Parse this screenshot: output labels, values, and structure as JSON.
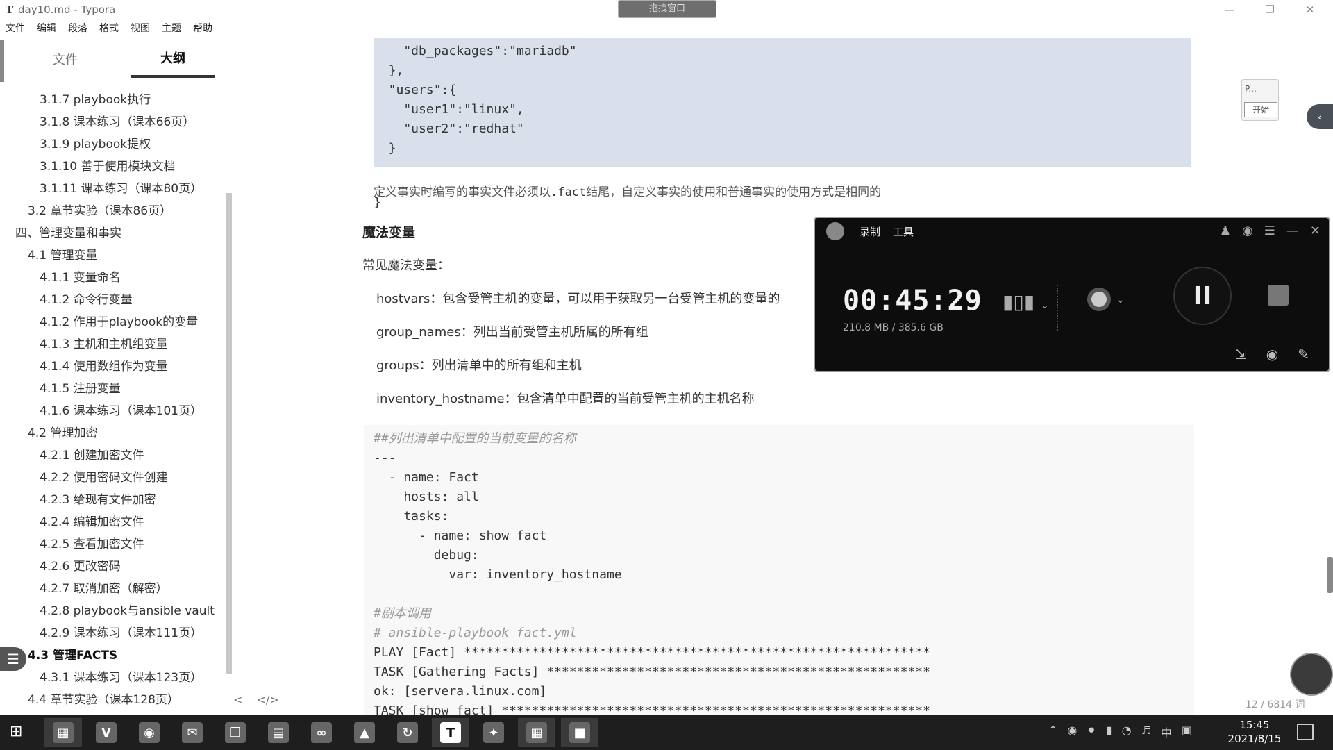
{
  "window": {
    "title": "day10.md - Typora",
    "app_icon": "T",
    "menu": [
      "文件",
      "编辑",
      "段落",
      "格式",
      "视图",
      "主题",
      "帮助"
    ],
    "tip_badge": "拖拽窗口"
  },
  "sidebar": {
    "tabs": [
      {
        "label": "文件",
        "active": false
      },
      {
        "label": "大纲",
        "active": true
      }
    ],
    "outline": [
      {
        "label": "3.1.7 playbook执行",
        "level": 3
      },
      {
        "label": "3.1.8 课本练习（课本66页）",
        "level": 3
      },
      {
        "label": "3.1.9 playbook提权",
        "level": 3
      },
      {
        "label": "3.1.10 善于使用模块文档",
        "level": 3
      },
      {
        "label": "3.1.11 课本练习（课本80页）",
        "level": 3
      },
      {
        "label": "3.2 章节实验（课本86页）",
        "level": 2
      },
      {
        "label": "四、管理变量和事实",
        "level": 1
      },
      {
        "label": "4.1 管理变量",
        "level": 2
      },
      {
        "label": "4.1.1 变量命名",
        "level": 3
      },
      {
        "label": "4.1.2 命令行变量",
        "level": 3
      },
      {
        "label": "4.1.2 作用于playbook的变量",
        "level": 3
      },
      {
        "label": "4.1.3 主机和主机组变量",
        "level": 3
      },
      {
        "label": "4.1.4 使用数组作为变量",
        "level": 3
      },
      {
        "label": "4.1.5 注册变量",
        "level": 3
      },
      {
        "label": "4.1.6 课本练习（课本101页）",
        "level": 3
      },
      {
        "label": "4.2 管理加密",
        "level": 2
      },
      {
        "label": "4.2.1 创建加密文件",
        "level": 3
      },
      {
        "label": "4.2.2 使用密码文件创建",
        "level": 3
      },
      {
        "label": "4.2.3 给现有文件加密",
        "level": 3
      },
      {
        "label": "4.2.4 编辑加密文件",
        "level": 3
      },
      {
        "label": "4.2.5 查看加密文件",
        "level": 3
      },
      {
        "label": "4.2.6 更改密码",
        "level": 3
      },
      {
        "label": "4.2.7 取消加密（解密）",
        "level": 3
      },
      {
        "label": "4.2.8 playbook与ansible vault",
        "level": 3
      },
      {
        "label": "4.2.9 课本练习（课本111页）",
        "level": 3
      },
      {
        "label": "4.3 管理FACTS",
        "level": 2,
        "active": true
      },
      {
        "label": "4.3.1 课本练习（课本123页）",
        "level": 3
      },
      {
        "label": "4.4 章节实验（课本128页）",
        "level": 2
      }
    ],
    "footer_prev": "<",
    "footer_source": "</>"
  },
  "editor": {
    "codeblock1": [
      "    \"db_packages\":\"mariadb\"",
      "  },",
      "  \"users\":{",
      "    \"user1\":\"linux\",",
      "    \"user2\":\"redhat\"",
      "  }"
    ],
    "codeblock1_tail": "}",
    "note_pre": "定义事实时编写的事实文件必须以",
    "note_code": ".fact",
    "note_post": "结尾，自定义事实的使用和普通事实的使用方式是相同的",
    "heading": "魔法变量",
    "intro": "常见魔法变量：",
    "items": [
      "hostvars：包含受管主机的变量，可以用于获取另一台受管主机的变量的",
      "group_names：列出当前受管主机所属的所有组",
      "groups：列出清单中的所有组和主机",
      "inventory_hostname：包含清单中配置的当前受管主机的主机名称"
    ],
    "codeblock2": [
      {
        "text": "##列出清单中配置的当前变量的名称",
        "comment": true
      },
      {
        "text": "---",
        "comment": false
      },
      {
        "text": "  - name: Fact",
        "comment": false
      },
      {
        "text": "    hosts: all",
        "comment": false
      },
      {
        "text": "    tasks:",
        "comment": false
      },
      {
        "text": "      - name: show fact",
        "comment": false
      },
      {
        "text": "        debug:",
        "comment": false
      },
      {
        "text": "          var: inventory_hostname",
        "comment": false
      },
      {
        "text": "",
        "comment": false
      },
      {
        "text": "#剧本调用",
        "comment": true
      },
      {
        "text": "# ansible-playbook fact.yml",
        "comment": true
      },
      {
        "text": "PLAY [Fact] **************************************************************",
        "comment": false
      },
      {
        "text": "TASK [Gathering Facts] ***************************************************",
        "comment": false
      },
      {
        "text": "ok: [servera.linux.com]",
        "comment": false
      },
      {
        "text": "TASK [show fact] *********************************************************",
        "comment": false
      }
    ],
    "word_count": "12 / 6814 词"
  },
  "mini_widget": {
    "top": "P...",
    "button": "开始"
  },
  "recorder": {
    "menu": [
      "录制",
      "工具"
    ],
    "time": "00:45:29",
    "size": "210.8 MB / 385.6 GB",
    "pause_glyph": "II"
  },
  "taskbar": {
    "apps": [
      "file-manager",
      "vivaldi",
      "circle-app",
      "wechat",
      "window-app",
      "folder",
      "network-app",
      "photos",
      "refresh-app",
      "typora",
      "share-app",
      "image-app",
      "recorder"
    ],
    "typora_glyph": "T",
    "ime": "中",
    "time": "15:45",
    "date": "2021/8/15"
  }
}
